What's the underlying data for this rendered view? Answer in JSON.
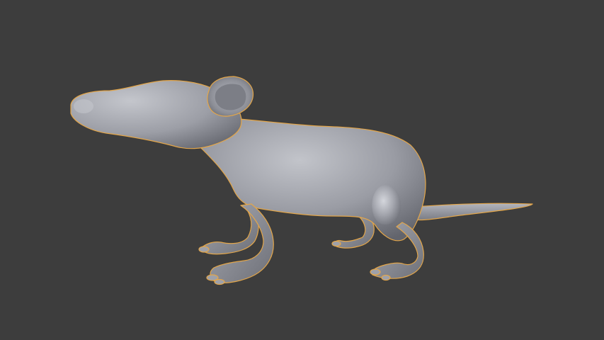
{
  "viewport": {
    "background": "#3d3d3d",
    "mode": "3d-viewport-object-mode"
  },
  "model": {
    "object": "rat-mesh",
    "shading": "solid-matcap-grey",
    "base_color": "#9a9ca4",
    "highlight_color": "#c4c6cc",
    "shadow_color": "#5e6068",
    "selection_outline_color": "#e3a64a",
    "selected": true
  }
}
